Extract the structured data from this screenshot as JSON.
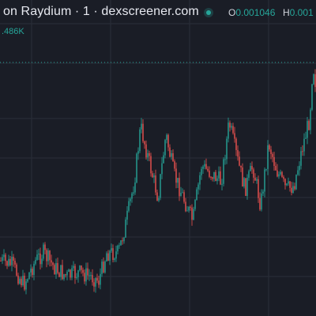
{
  "header": {
    "title": "on Raydium · 1 · dexscreener.com",
    "ohlc": [
      {
        "key": "O",
        "value": "0.001046"
      },
      {
        "key": "H",
        "value": "0.001"
      }
    ]
  },
  "volume_label": ".486K",
  "colors": {
    "background": "#1a1d26",
    "up": "#26a69a",
    "down": "#ef5350",
    "grid": "#2a2e39",
    "price_line": "#26a69a"
  },
  "chart_data": {
    "type": "candlestick",
    "title": "",
    "grid": true,
    "price_line": true
  }
}
